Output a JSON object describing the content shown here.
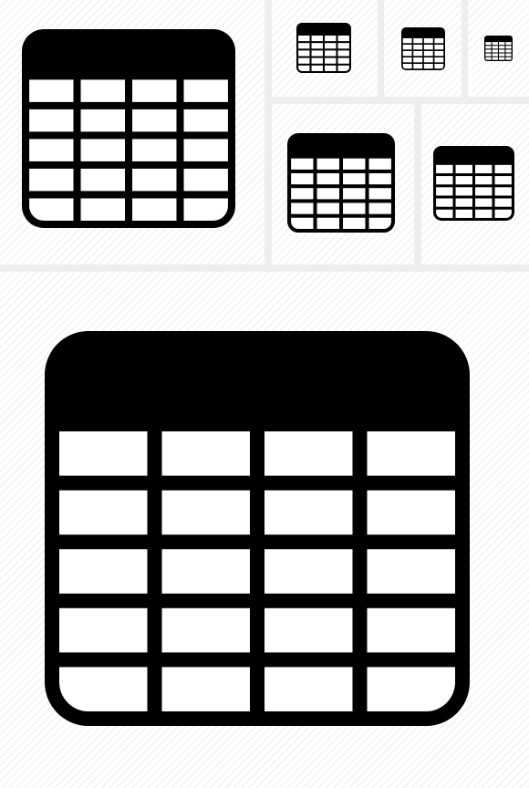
{
  "sheet": {
    "background": "#ffffff",
    "hatch_color": "#ececec",
    "divider_color": "#eeeeee",
    "icon_color": "#000000",
    "cell_color": "#ffffff"
  },
  "icons": [
    {
      "name": "table-icon-large-preview",
      "columns": 4,
      "rows": 5
    },
    {
      "name": "table-icon-medium",
      "columns": 4,
      "rows": 5
    },
    {
      "name": "table-icon-small",
      "columns": 4,
      "rows": 5
    },
    {
      "name": "table-icon-tiny",
      "columns": 4,
      "rows": 5
    },
    {
      "name": "table-icon-medium-large",
      "columns": 4,
      "rows": 5
    },
    {
      "name": "table-icon-medium-wide",
      "columns": 4,
      "rows": 5
    },
    {
      "name": "table-icon-hero",
      "columns": 4,
      "rows": 5
    }
  ]
}
